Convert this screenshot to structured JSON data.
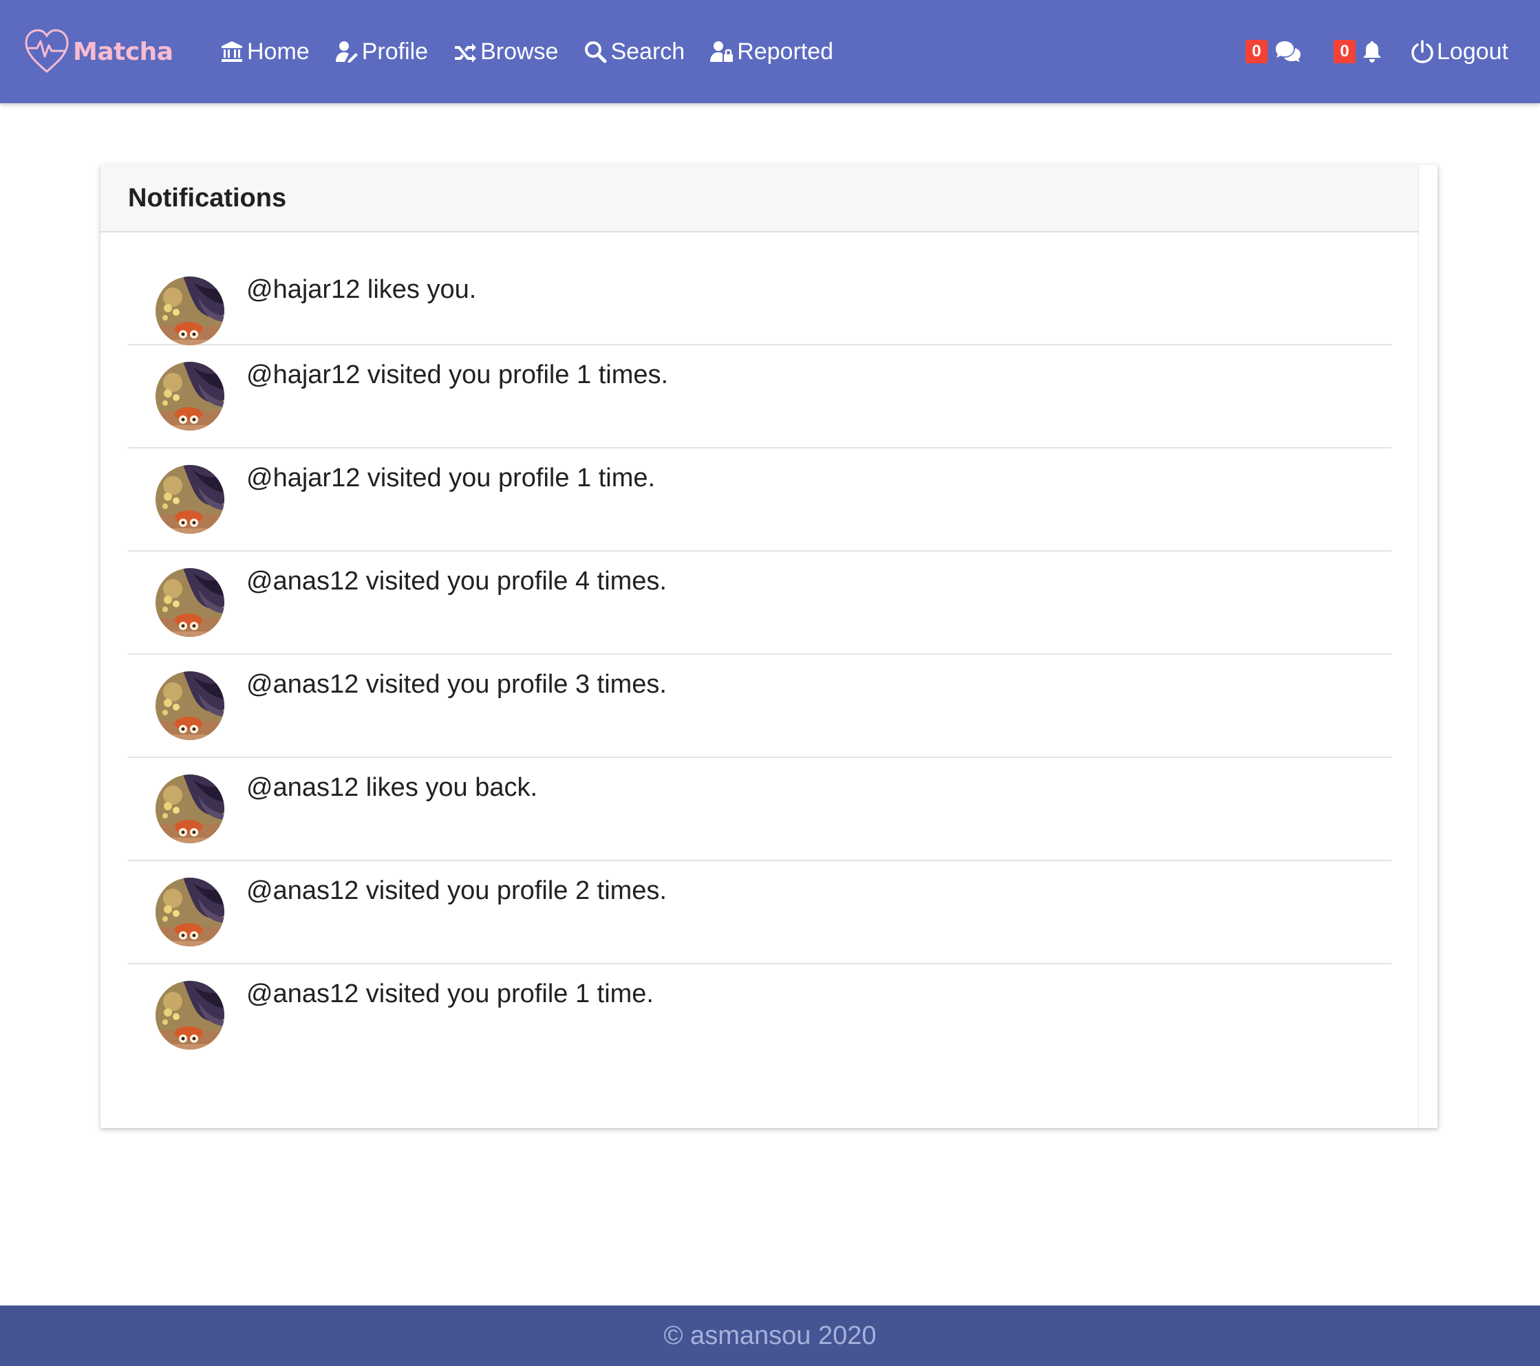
{
  "app": {
    "brand": "Matcha"
  },
  "nav": {
    "links": [
      {
        "label": "Home",
        "icon": "bank-icon"
      },
      {
        "label": "Profile",
        "icon": "user-edit-icon"
      },
      {
        "label": "Browse",
        "icon": "shuffle-icon"
      },
      {
        "label": "Search",
        "icon": "search-icon"
      },
      {
        "label": "Reported",
        "icon": "user-lock-icon"
      }
    ],
    "messages_count": "0",
    "notifications_count": "0",
    "logout_label": "Logout"
  },
  "notifications": {
    "title": "Notifications",
    "items": [
      {
        "text": "@hajar12 likes you."
      },
      {
        "text": "@hajar12 visited you profile 1 times."
      },
      {
        "text": "@hajar12 visited you profile 1 time."
      },
      {
        "text": "@anas12 visited you profile 4 times."
      },
      {
        "text": "@anas12 visited you profile 3 times."
      },
      {
        "text": "@anas12 likes you back."
      },
      {
        "text": "@anas12 visited you profile 2 times."
      },
      {
        "text": "@anas12 visited you profile 1 time."
      }
    ]
  },
  "footer": {
    "text": "© asmansou 2020"
  },
  "colors": {
    "navbar": "#5c6bc0",
    "brand": "#f8bbd0",
    "badge": "#f44336",
    "footer": "#455493"
  }
}
